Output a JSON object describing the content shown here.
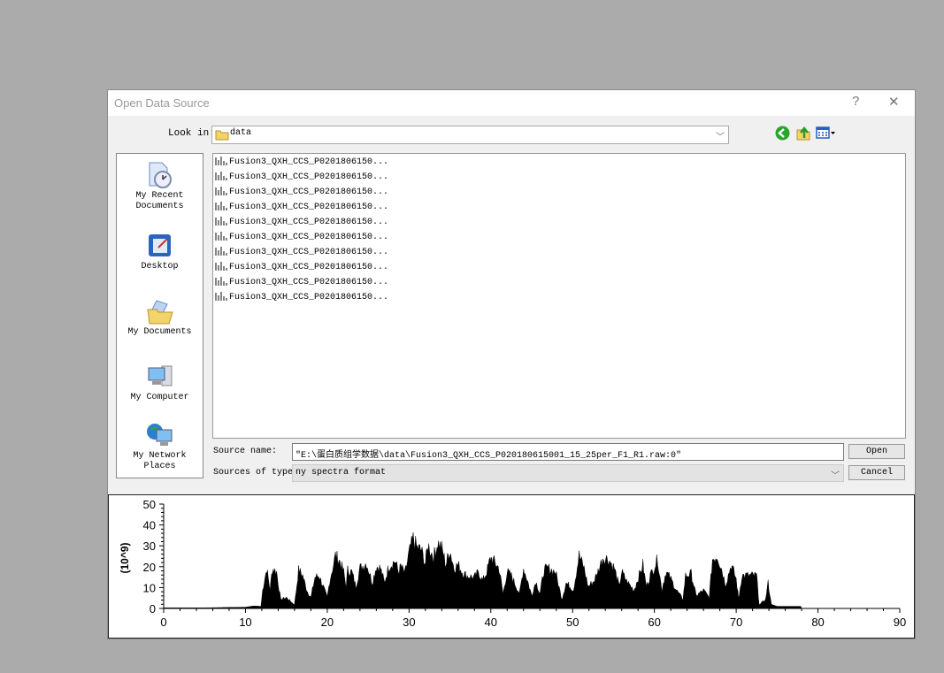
{
  "dialog": {
    "title": "Open Data Source",
    "help_label": "?",
    "close_label": "✕",
    "look_in_label": "Look in:",
    "look_in_value": "data",
    "nav_icons": [
      "back-icon",
      "up-folder-icon",
      "view-menu-icon"
    ]
  },
  "places": [
    {
      "label_1": "My Recent",
      "label_2": "Documents",
      "icon": "recent-documents-icon"
    },
    {
      "label_1": "Desktop",
      "label_2": "",
      "icon": "desktop-icon"
    },
    {
      "label_1": "My Documents",
      "label_2": "",
      "icon": "my-documents-icon"
    },
    {
      "label_1": "My Computer",
      "label_2": "",
      "icon": "my-computer-icon"
    },
    {
      "label_1": "My Network",
      "label_2": "Places",
      "icon": "network-places-icon"
    }
  ],
  "files": [
    "Fusion3_QXH_CCS_P0201806150...",
    "Fusion3_QXH_CCS_P0201806150...",
    "Fusion3_QXH_CCS_P0201806150...",
    "Fusion3_QXH_CCS_P0201806150...",
    "Fusion3_QXH_CCS_P0201806150...",
    "Fusion3_QXH_CCS_P0201806150...",
    "Fusion3_QXH_CCS_P0201806150...",
    "Fusion3_QXH_CCS_P0201806150...",
    "Fusion3_QXH_CCS_P0201806150...",
    "Fusion3_QXH_CCS_P0201806150..."
  ],
  "source_name": {
    "label": "Source name:",
    "value": "\"E:\\蛋白质组学数据\\data\\Fusion3_QXH_CCS_P020180615001_15_25per_F1_R1.raw:0\""
  },
  "source_type": {
    "label": "Sources of type:",
    "value": "ny spectra format"
  },
  "buttons": {
    "open": "Open",
    "cancel": "Cancel"
  },
  "chart_data": {
    "type": "area",
    "ylabel": "(10^9)",
    "xlabel": "",
    "xlim": [
      0,
      90
    ],
    "ylim": [
      0,
      50
    ],
    "x_ticks": [
      0,
      10,
      20,
      30,
      40,
      50,
      60,
      70,
      80,
      90
    ],
    "y_ticks": [
      0,
      10,
      20,
      30,
      40,
      50
    ],
    "grid": false,
    "color": "#000000",
    "points": [
      [
        0,
        0.3
      ],
      [
        5,
        0.3
      ],
      [
        8,
        0.5
      ],
      [
        10,
        0.6
      ],
      [
        11,
        1.2
      ],
      [
        11.9,
        1
      ],
      [
        12.1,
        10
      ],
      [
        12.6,
        22
      ],
      [
        13,
        10
      ],
      [
        13.3,
        22
      ],
      [
        13.8,
        20
      ],
      [
        14.3,
        5
      ],
      [
        15,
        6
      ],
      [
        15.5,
        4
      ],
      [
        16,
        2
      ],
      [
        16.5,
        21
      ],
      [
        17,
        18
      ],
      [
        17.5,
        10
      ],
      [
        18,
        6
      ],
      [
        18.5,
        17
      ],
      [
        19,
        18
      ],
      [
        19.5,
        12
      ],
      [
        20,
        6
      ],
      [
        20.3,
        15
      ],
      [
        21,
        29
      ],
      [
        21.5,
        26
      ],
      [
        22,
        20
      ],
      [
        22.3,
        12
      ],
      [
        22.5,
        21
      ],
      [
        23,
        20
      ],
      [
        23.5,
        12
      ],
      [
        24,
        22
      ],
      [
        24.8,
        25
      ],
      [
        25.5,
        14
      ],
      [
        26,
        23
      ],
      [
        26.5,
        22
      ],
      [
        27,
        14
      ],
      [
        27.5,
        23
      ],
      [
        28.3,
        26
      ],
      [
        28.7,
        20
      ],
      [
        29,
        23
      ],
      [
        29.5,
        19
      ],
      [
        30,
        30
      ],
      [
        30.5,
        38
      ],
      [
        31,
        33
      ],
      [
        31.5,
        32
      ],
      [
        32,
        24
      ],
      [
        32.3,
        35
      ],
      [
        33,
        28
      ],
      [
        33.5,
        36
      ],
      [
        34,
        33
      ],
      [
        34.5,
        24
      ],
      [
        35,
        32
      ],
      [
        35.5,
        22
      ],
      [
        36,
        24
      ],
      [
        36.5,
        20
      ],
      [
        37,
        18
      ],
      [
        38,
        17
      ],
      [
        38.5,
        20
      ],
      [
        39,
        15
      ],
      [
        39.5,
        20
      ],
      [
        40,
        28
      ],
      [
        40.5,
        25
      ],
      [
        41,
        22
      ],
      [
        41.5,
        8
      ],
      [
        42,
        20
      ],
      [
        42.5,
        18
      ],
      [
        43,
        13
      ],
      [
        43.5,
        8
      ],
      [
        44,
        22
      ],
      [
        44.5,
        15
      ],
      [
        45,
        7
      ],
      [
        45.5,
        15
      ],
      [
        46,
        8
      ],
      [
        46.5,
        21
      ],
      [
        47,
        22
      ],
      [
        47.9,
        20
      ],
      [
        48.7,
        5
      ],
      [
        49.2,
        14
      ],
      [
        49.7,
        12
      ],
      [
        50.1,
        10
      ],
      [
        50.8,
        29
      ],
      [
        51.4,
        22
      ],
      [
        51.9,
        12
      ],
      [
        52.6,
        15
      ],
      [
        53,
        19
      ],
      [
        53.7,
        28
      ],
      [
        54.4,
        27
      ],
      [
        55.1,
        22
      ],
      [
        55.7,
        12
      ],
      [
        56,
        20
      ],
      [
        56.6,
        15
      ],
      [
        57.5,
        10
      ],
      [
        58.6,
        24
      ],
      [
        59,
        12
      ],
      [
        59.5,
        18
      ],
      [
        60.4,
        27
      ],
      [
        60.9,
        10
      ],
      [
        61.4,
        20
      ],
      [
        61.9,
        17
      ],
      [
        62.7,
        10
      ],
      [
        63.5,
        5
      ],
      [
        63.8,
        18
      ],
      [
        64.5,
        19
      ],
      [
        65.1,
        7
      ],
      [
        66,
        10
      ],
      [
        66.7,
        6
      ],
      [
        67.1,
        27
      ],
      [
        67.7,
        29
      ],
      [
        68.2,
        22
      ],
      [
        68.7,
        13
      ],
      [
        69.4,
        24
      ],
      [
        70,
        16
      ],
      [
        70.3,
        5
      ],
      [
        70.7,
        18
      ],
      [
        71.4,
        18
      ],
      [
        72.5,
        18
      ],
      [
        72.8,
        2
      ],
      [
        73.6,
        5
      ],
      [
        73.9,
        14
      ],
      [
        74.3,
        2
      ],
      [
        75,
        1
      ],
      [
        77.9,
        1
      ],
      [
        78,
        0
      ]
    ]
  }
}
